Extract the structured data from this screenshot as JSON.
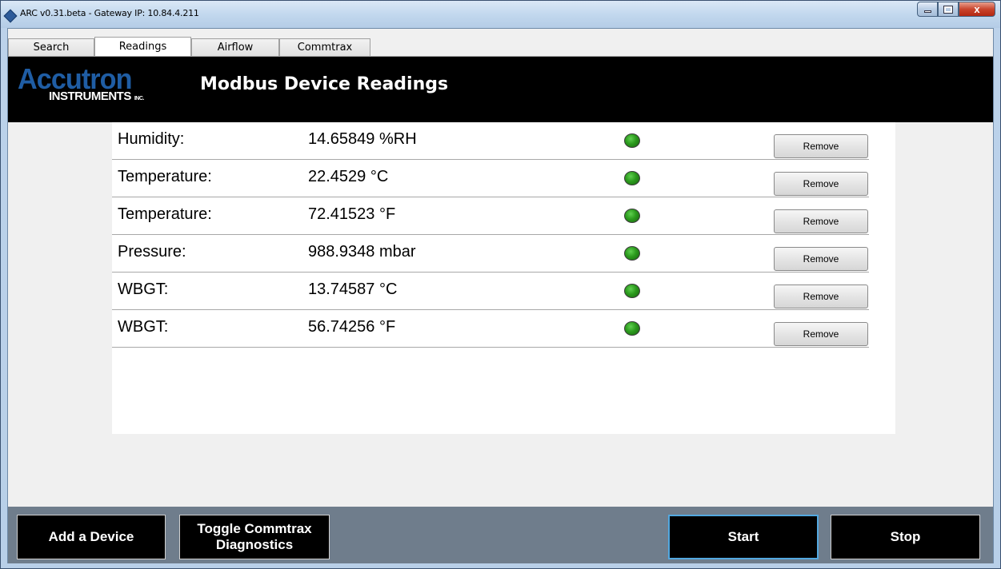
{
  "window": {
    "title": "ARC v0.31.beta - Gateway IP: 10.84.4.211",
    "controls": {
      "minimize": "",
      "maximize": "",
      "close": "x"
    }
  },
  "tabs": [
    {
      "label": "Search"
    },
    {
      "label": "Readings",
      "active": true
    },
    {
      "label": "Airflow"
    },
    {
      "label": "Commtrax"
    }
  ],
  "header": {
    "logo_main": "Accutron",
    "logo_sub": "INSTRUMENTS",
    "logo_inc": "INC.",
    "title": "Modbus Device Readings"
  },
  "readings": [
    {
      "label": "Humidity:",
      "value": "14.65849 %RH",
      "status_color": "#2b9a1d",
      "remove_label": "Remove"
    },
    {
      "label": "Temperature:",
      "value": "22.4529 °C",
      "status_color": "#2b9a1d",
      "remove_label": "Remove"
    },
    {
      "label": "Temperature:",
      "value": "72.41523 °F",
      "status_color": "#2b9a1d",
      "remove_label": "Remove"
    },
    {
      "label": "Pressure:",
      "value": "988.9348 mbar",
      "status_color": "#2b9a1d",
      "remove_label": "Remove"
    },
    {
      "label": "WBGT:",
      "value": "13.74587 °C",
      "status_color": "#2b9a1d",
      "remove_label": "Remove"
    },
    {
      "label": "WBGT:",
      "value": "56.74256 °F",
      "status_color": "#2b9a1d",
      "remove_label": "Remove"
    }
  ],
  "bottom": {
    "add_device": "Add a Device",
    "toggle_line1": "Toggle Commtrax",
    "toggle_line2": "Diagnostics",
    "start": "Start",
    "stop": "Stop"
  },
  "colors": {
    "logo_blue": "#1f5da4",
    "header_bg": "#000000",
    "bottom_bar_bg": "#6f7d8c",
    "focus_border": "#52a8e0"
  }
}
